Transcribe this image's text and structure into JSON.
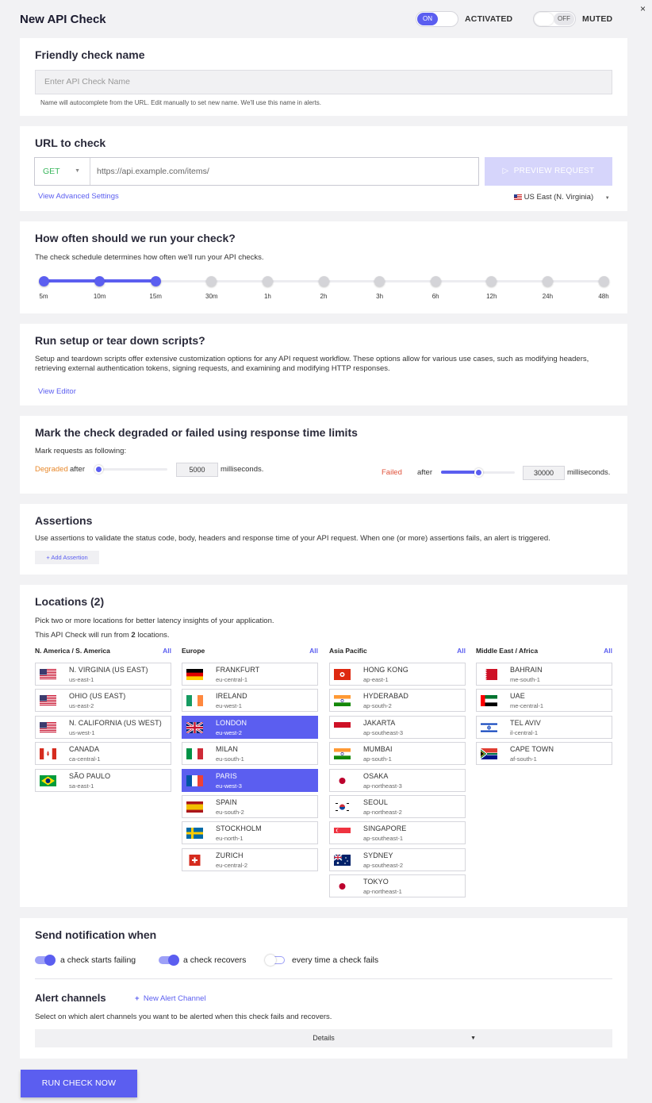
{
  "header": {
    "title": "New API Check",
    "activated_toggle": "ON",
    "activated_label": "ACTIVATED",
    "muted_toggle": "OFF",
    "muted_label": "MUTED",
    "close": "×"
  },
  "name_section": {
    "title": "Friendly check name",
    "placeholder": "Enter API Check Name",
    "hint": "Name will autocomplete from the URL. Edit manually to set new name. We'll use this name in alerts."
  },
  "url_section": {
    "title": "URL to check",
    "method": "GET",
    "url_placeholder": "https://api.example.com/items/",
    "preview_button": "PREVIEW REQUEST",
    "advanced_link": "View Advanced Settings",
    "region": "US East (N. Virginia)"
  },
  "schedule": {
    "title": "How often should we run your check?",
    "description": "The check schedule determines how often we'll run your API checks.",
    "ticks": [
      "5m",
      "10m",
      "15m",
      "30m",
      "1h",
      "2h",
      "3h",
      "6h",
      "12h",
      "24h",
      "48h"
    ],
    "selected_index": 2
  },
  "scripts": {
    "title": "Run setup or tear down scripts?",
    "description": "Setup and teardown scripts offer extensive customization options for any API request workflow. These options allow for various use cases, such as modifying headers, retrieving external authentication tokens, signing requests, and examining and modifying HTTP responses.",
    "editor_link": "View Editor"
  },
  "limits": {
    "title": "Mark the check degraded or failed using response time limits",
    "intro": "Mark requests as following:",
    "degraded_label": "Degraded",
    "failed_label": "Failed",
    "after": "after",
    "degraded_value": "5000",
    "failed_value": "30000",
    "unit": "milliseconds.",
    "degraded_fraction": 0.0,
    "failed_fraction": 0.5,
    "degraded_color": "#e8892c",
    "failed_color": "#e0513a"
  },
  "assertions": {
    "title": "Assertions",
    "description": "Use assertions to validate the status code, body, headers and response time of your API request. When one (or more) assertions fails, an alert is triggered.",
    "add_button": "+  Add Assertion"
  },
  "locations": {
    "title": "Locations (2)",
    "intro": "Pick two or more locations for better latency insights of your application.",
    "run_from_prefix": "This API Check will run from ",
    "run_from_count": "2",
    "run_from_suffix": " locations.",
    "all_label": "All",
    "columns": [
      {
        "name": "N. America / S. America",
        "items": [
          {
            "name": "N. VIRGINIA (US EAST)",
            "code": "us-east-1",
            "flag": "us",
            "selected": false
          },
          {
            "name": "OHIO (US EAST)",
            "code": "us-east-2",
            "flag": "us",
            "selected": false
          },
          {
            "name": "N. CALIFORNIA (US WEST)",
            "code": "us-west-1",
            "flag": "us",
            "selected": false
          },
          {
            "name": "CANADA",
            "code": "ca-central-1",
            "flag": "ca",
            "selected": false
          },
          {
            "name": "SÃO PAULO",
            "code": "sa-east-1",
            "flag": "br",
            "selected": false
          }
        ]
      },
      {
        "name": "Europe",
        "items": [
          {
            "name": "FRANKFURT",
            "code": "eu-central-1",
            "flag": "de",
            "selected": false
          },
          {
            "name": "IRELAND",
            "code": "eu-west-1",
            "flag": "ie",
            "selected": false
          },
          {
            "name": "LONDON",
            "code": "eu-west-2",
            "flag": "gb",
            "selected": true
          },
          {
            "name": "MILAN",
            "code": "eu-south-1",
            "flag": "it",
            "selected": false
          },
          {
            "name": "PARIS",
            "code": "eu-west-3",
            "flag": "fr",
            "selected": true
          },
          {
            "name": "SPAIN",
            "code": "eu-south-2",
            "flag": "es",
            "selected": false
          },
          {
            "name": "STOCKHOLM",
            "code": "eu-north-1",
            "flag": "se",
            "selected": false
          },
          {
            "name": "ZURICH",
            "code": "eu-central-2",
            "flag": "ch",
            "selected": false
          }
        ]
      },
      {
        "name": "Asia Pacific",
        "items": [
          {
            "name": "HONG KONG",
            "code": "ap-east-1",
            "flag": "hk",
            "selected": false
          },
          {
            "name": "HYDERABAD",
            "code": "ap-south-2",
            "flag": "in",
            "selected": false
          },
          {
            "name": "JAKARTA",
            "code": "ap-southeast-3",
            "flag": "id",
            "selected": false
          },
          {
            "name": "MUMBAI",
            "code": "ap-south-1",
            "flag": "in",
            "selected": false
          },
          {
            "name": "OSAKA",
            "code": "ap-northeast-3",
            "flag": "jp",
            "selected": false
          },
          {
            "name": "SEOUL",
            "code": "ap-northeast-2",
            "flag": "kr",
            "selected": false
          },
          {
            "name": "SINGAPORE",
            "code": "ap-southeast-1",
            "flag": "sg",
            "selected": false
          },
          {
            "name": "SYDNEY",
            "code": "ap-southeast-2",
            "flag": "au",
            "selected": false
          },
          {
            "name": "TOKYO",
            "code": "ap-northeast-1",
            "flag": "jp",
            "selected": false
          }
        ]
      },
      {
        "name": "Middle East / Africa",
        "items": [
          {
            "name": "BAHRAIN",
            "code": "me-south-1",
            "flag": "bh",
            "selected": false
          },
          {
            "name": "UAE",
            "code": "me-central-1",
            "flag": "ae",
            "selected": false
          },
          {
            "name": "TEL AVIV",
            "code": "il-central-1",
            "flag": "il",
            "selected": false
          },
          {
            "name": "CAPE TOWN",
            "code": "af-south-1",
            "flag": "za",
            "selected": false
          }
        ]
      }
    ]
  },
  "notifications": {
    "title": "Send notification when",
    "options": [
      {
        "label": "a check starts failing",
        "on": true
      },
      {
        "label": "a check recovers",
        "on": true
      },
      {
        "label": "every time a check fails",
        "on": false
      }
    ],
    "alert_title": "Alert channels",
    "new_channel": "New Alert Channel",
    "alert_description": "Select on which alert channels you want to be alerted when this check fails and recovers.",
    "details": "Details"
  },
  "run_button": "RUN CHECK NOW",
  "colors": {
    "accent": "#5b5ef0",
    "accent_light": "#d6d5fb",
    "method_green": "#3bb75e"
  }
}
